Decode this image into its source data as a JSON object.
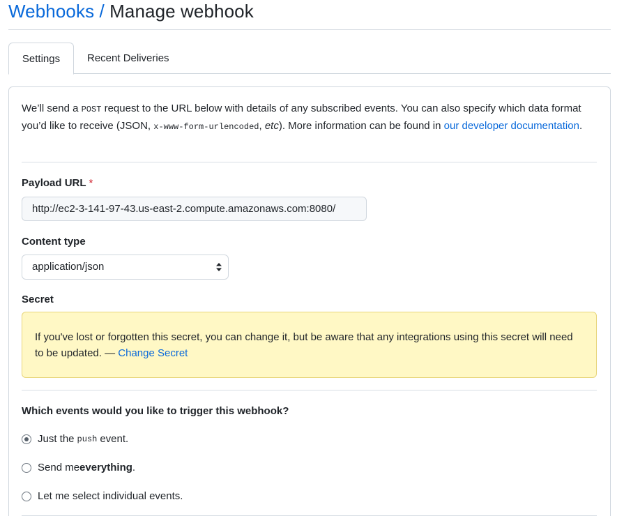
{
  "header": {
    "breadcrumb": "Webhooks",
    "separator": "/",
    "title": "Manage webhook"
  },
  "tabs": [
    {
      "label": "Settings",
      "active": true
    },
    {
      "label": "Recent Deliveries",
      "active": false
    }
  ],
  "intro": {
    "part1": "We’ll send a ",
    "code1": "POST",
    "part2": " request to the URL below with details of any subscribed events. You can also specify which data format you’d like to receive (JSON, ",
    "code2": "x-www-form-urlencoded",
    "part3": ", ",
    "italic": "etc",
    "part4": "). More information can be found in ",
    "link": "our developer documentation",
    "part5": "."
  },
  "payload": {
    "label": "Payload URL",
    "required_mark": "*",
    "value": "http://ec2-3-141-97-43.us-east-2.compute.amazonaws.com:8080/"
  },
  "content_type": {
    "label": "Content type",
    "selected": "application/json"
  },
  "secret": {
    "label": "Secret",
    "notice": "If you've lost or forgotten this secret, you can change it, but be aware that any integrations using this secret will need to be updated. — ",
    "link": "Change Secret"
  },
  "events": {
    "question": "Which events would you like to trigger this webhook?",
    "option1": {
      "pre": "Just the",
      "code": "push",
      "post": "event.",
      "checked": true
    },
    "option2": {
      "pre": "Send me ",
      "bold": "everything",
      "post": ".",
      "checked": false
    },
    "option3": {
      "label": "Let me select individual events.",
      "checked": false
    }
  },
  "colors": {
    "link": "#0969da",
    "required": "#cf222e",
    "flash_bg": "#fff8c5",
    "flash_border": "#e7d57a",
    "border": "#d0d7de"
  }
}
